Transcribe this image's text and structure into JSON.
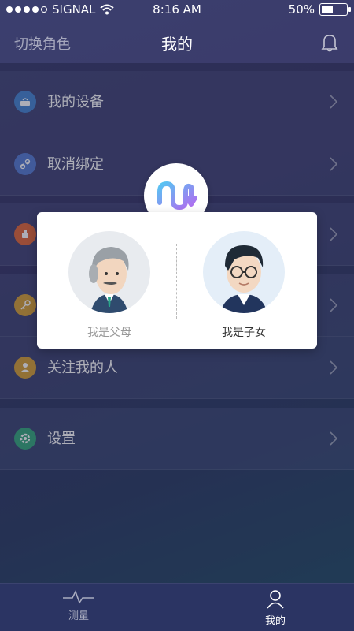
{
  "status": {
    "carrier": "SIGNAL",
    "time": "8:16 AM",
    "battery": "50%",
    "battery_level": 0.5
  },
  "nav": {
    "left": "切换角色",
    "title": "我的",
    "bell_icon": "bell-icon"
  },
  "menu": {
    "section1": [
      {
        "label": "我的设备",
        "icon": "router-icon",
        "color": "#4a87d3"
      },
      {
        "label": "取消绑定",
        "icon": "unlink-icon",
        "color": "#5a7ed3"
      }
    ],
    "section2": [
      {
        "label": "",
        "icon": "alarm-icon",
        "color": "#e26a3c"
      }
    ],
    "section3": [
      {
        "label": "",
        "icon": "key-icon",
        "color": "#d6a23a"
      },
      {
        "label": "关注我的人",
        "icon": "person-icon",
        "color": "#d6a23a"
      }
    ],
    "section4": [
      {
        "label": "设置",
        "icon": "gear-icon",
        "color": "#3aa97e"
      }
    ]
  },
  "dialog": {
    "parent_label": "我是父母",
    "child_label": "我是子女"
  },
  "tabbar": {
    "tabs": [
      {
        "label": "测量",
        "icon": "pulse-icon"
      },
      {
        "label": "我的",
        "icon": "user-icon",
        "active": true
      }
    ]
  }
}
